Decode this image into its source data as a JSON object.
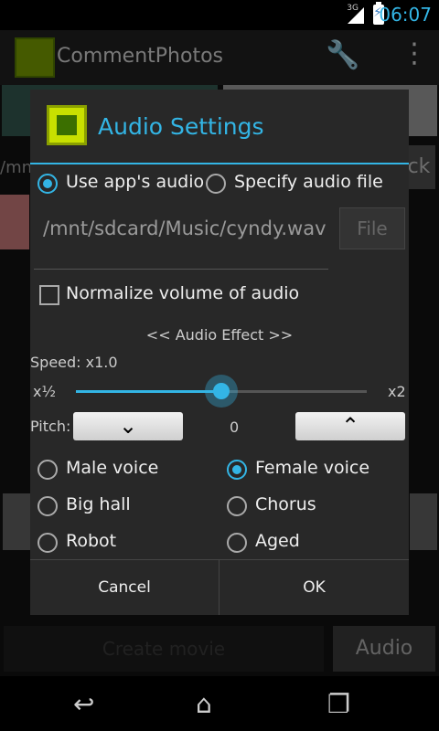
{
  "status_bar": {
    "network": "3G",
    "time": "06:07"
  },
  "app": {
    "title": "CommentPhotos",
    "background_path_fragment": "/mn",
    "background_button_fragment": "ck",
    "create_movie_label": "Create movie",
    "audio_button_label": "Audio"
  },
  "dialog": {
    "title": "Audio Settings",
    "source_options": [
      "Use app's audio",
      "Specify audio file"
    ],
    "selected_source": "Use app's audio",
    "file_path": "/mnt/sdcard/Music/cyndy.wav",
    "file_button_label": "File",
    "normalize_label": "Normalize volume of audio",
    "normalize_checked": false,
    "effect_heading": "<< Audio Effect >>",
    "speed": {
      "label": "Speed: x1.0",
      "min_label": "x½",
      "max_label": "x2",
      "value": 1.0,
      "min": 0.5,
      "max": 2.0,
      "fill_fraction": 0.5
    },
    "pitch": {
      "label": "Pitch:",
      "value": "0"
    },
    "voices": {
      "male": "Male voice",
      "female": "Female voice",
      "big_hall": "Big hall",
      "chorus": "Chorus",
      "robot": "Robot",
      "aged": "Aged"
    },
    "selected_voice": "Female voice",
    "cancel_label": "Cancel",
    "ok_label": "OK"
  },
  "colors": {
    "accent": "#33b5e5"
  }
}
